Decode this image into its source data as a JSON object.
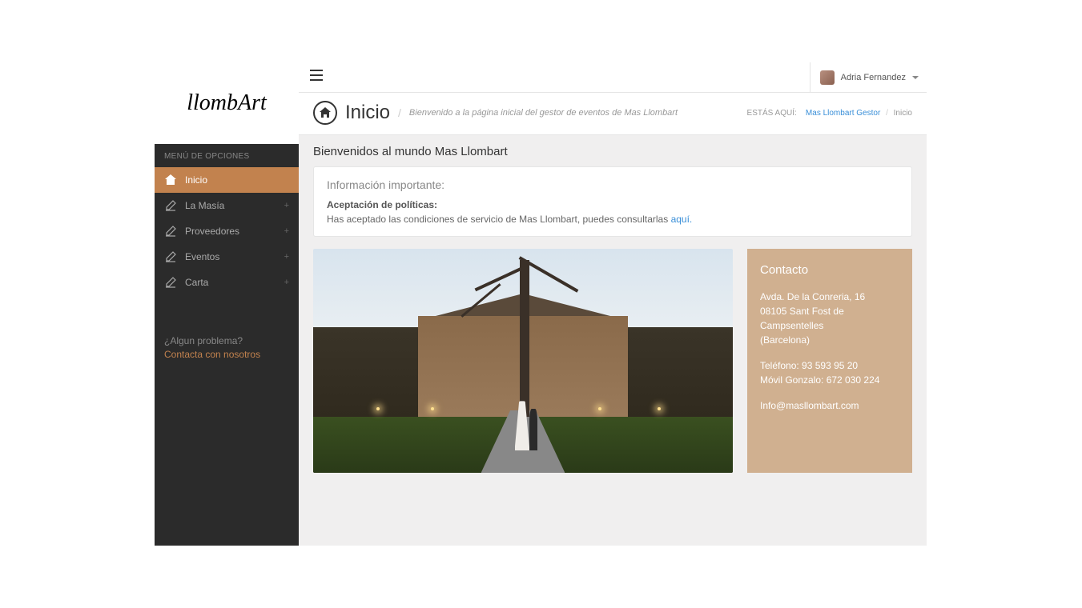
{
  "logo_text": "llombArt",
  "sidebar": {
    "menu_title": "MENÚ DE OPCIONES",
    "items": [
      {
        "label": "Inicio",
        "icon": "home",
        "active": true,
        "expandable": false
      },
      {
        "label": "La Masía",
        "icon": "edit",
        "active": false,
        "expandable": true
      },
      {
        "label": "Proveedores",
        "icon": "edit",
        "active": false,
        "expandable": true
      },
      {
        "label": "Eventos",
        "icon": "edit",
        "active": false,
        "expandable": true
      },
      {
        "label": "Carta",
        "icon": "edit",
        "active": false,
        "expandable": true
      }
    ],
    "help_question": "¿Algun problema?",
    "help_link": "Contacta con nosotros"
  },
  "topbar": {
    "user_name": "Adria Fernandez"
  },
  "header": {
    "title": "Inicio",
    "subtitle": "Bienvenido a la página inicial del gestor de eventos de Mas Llombart",
    "breadcrumb_label": "ESTÁS AQUÍ:",
    "breadcrumb_link": "Mas Llombart Gestor",
    "breadcrumb_current": "Inicio"
  },
  "content": {
    "welcome": "Bienvenidos al mundo Mas Llombart",
    "info_title": "Información importante:",
    "info_subtitle": "Aceptación de políticas:",
    "info_text": "Has aceptado las condiciones de servicio de Mas Llombart, puedes consultarlas ",
    "info_link": "aquí."
  },
  "contact": {
    "title": "Contacto",
    "address_line1": "Avda. De la Conreria, 16",
    "address_line2": "08105 Sant Fost de Campsentelles",
    "address_line3": "(Barcelona)",
    "phone": "Teléfono: 93 593 95 20",
    "mobile": "Móvil Gonzalo: 672 030 224",
    "email": "Info@masllombart.com"
  }
}
